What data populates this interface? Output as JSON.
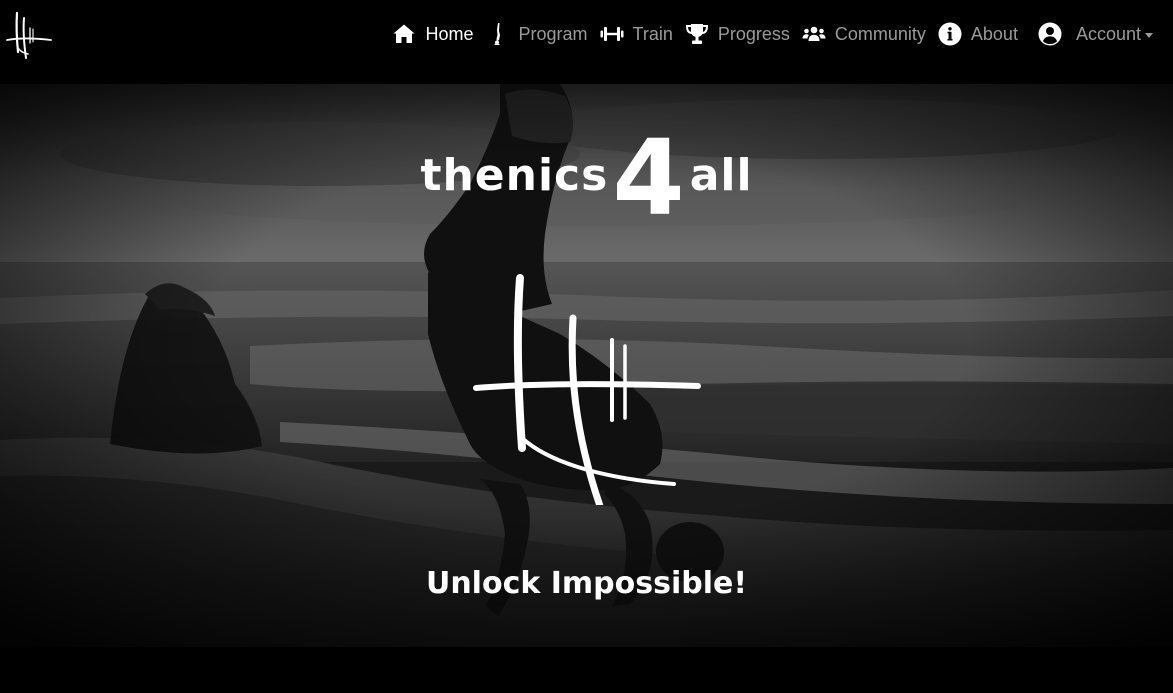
{
  "nav": {
    "brand_logo": "tally-marks-logo",
    "items": [
      {
        "label": "Home",
        "icon": "home-icon",
        "active": true
      },
      {
        "label": "Program",
        "icon": "handstand-figure-icon",
        "active": false
      },
      {
        "label": "Train",
        "icon": "dumbbell-icon",
        "active": false
      },
      {
        "label": "Progress",
        "icon": "trophy-icon",
        "active": false
      },
      {
        "label": "Community",
        "icon": "users-icon",
        "active": false
      },
      {
        "label": "About",
        "icon": "info-circle-icon",
        "active": false
      }
    ],
    "account": {
      "label": "Account",
      "icon": "user-circle-icon"
    }
  },
  "hero": {
    "wordmark": {
      "left": "thenics",
      "number": "4",
      "right": "all"
    },
    "logo": "tally-marks-logo",
    "tagline": "Unlock Impossible!"
  },
  "colors": {
    "background": "#000000",
    "nav_text": "#9a9a9a",
    "nav_active": "#ffffff",
    "hero_text": "#ffffff"
  }
}
